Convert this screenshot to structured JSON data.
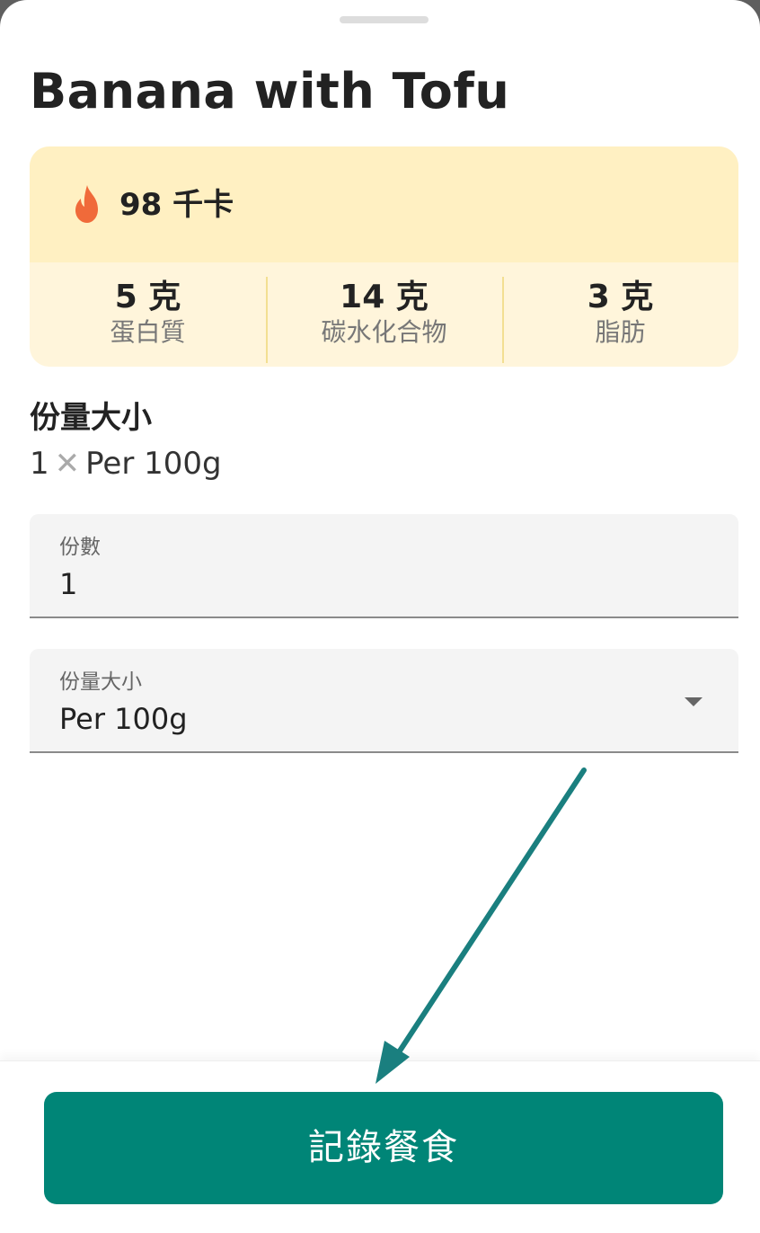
{
  "meal": {
    "title": "Banana with Tofu",
    "calories": "98 千卡",
    "icon": "flame-icon",
    "accent": "#f06a3a"
  },
  "macros": [
    {
      "value": "5 克",
      "label": "蛋白質"
    },
    {
      "value": "14 克",
      "label": "碳水化合物"
    },
    {
      "value": "3 克",
      "label": "脂肪"
    }
  ],
  "serving": {
    "section_title": "份量大小",
    "summary_count": "1",
    "summary_times": "✕",
    "summary_unit": "Per 100g"
  },
  "fields": {
    "servings_label": "份數",
    "servings_value": "1",
    "size_label": "份量大小",
    "size_value": "Per 100g"
  },
  "footer": {
    "log_button_label": "記錄餐食",
    "button_color": "#008577"
  },
  "annotation": {
    "arrow_color": "#1a7f7f"
  }
}
